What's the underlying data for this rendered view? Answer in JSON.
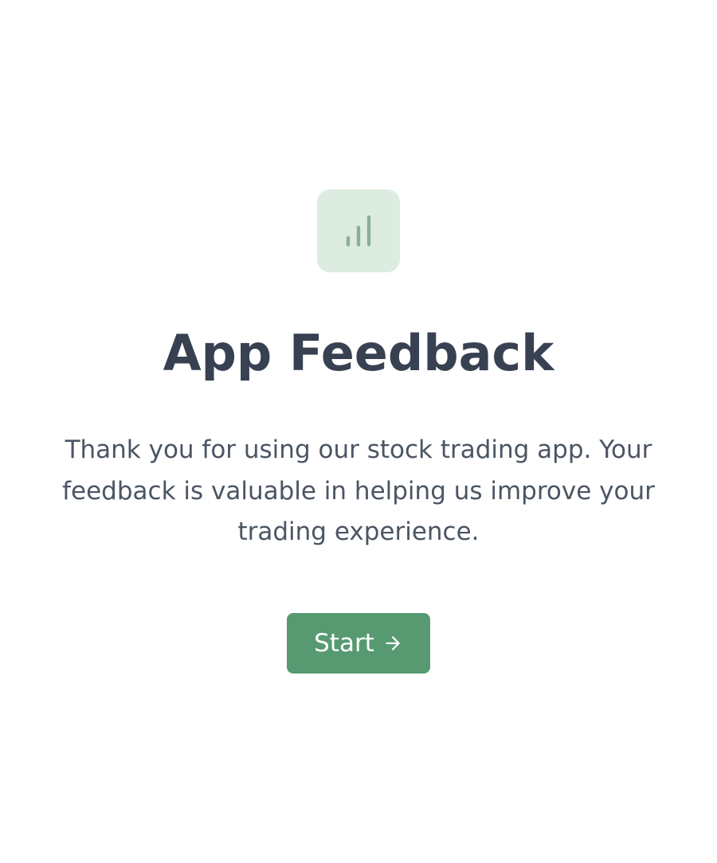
{
  "header": {
    "title": "App Feedback"
  },
  "main": {
    "description": "Thank you for using our stock trading app. Your feedback is valuable in helping us improve your trading experience."
  },
  "actions": {
    "start_label": "Start"
  }
}
